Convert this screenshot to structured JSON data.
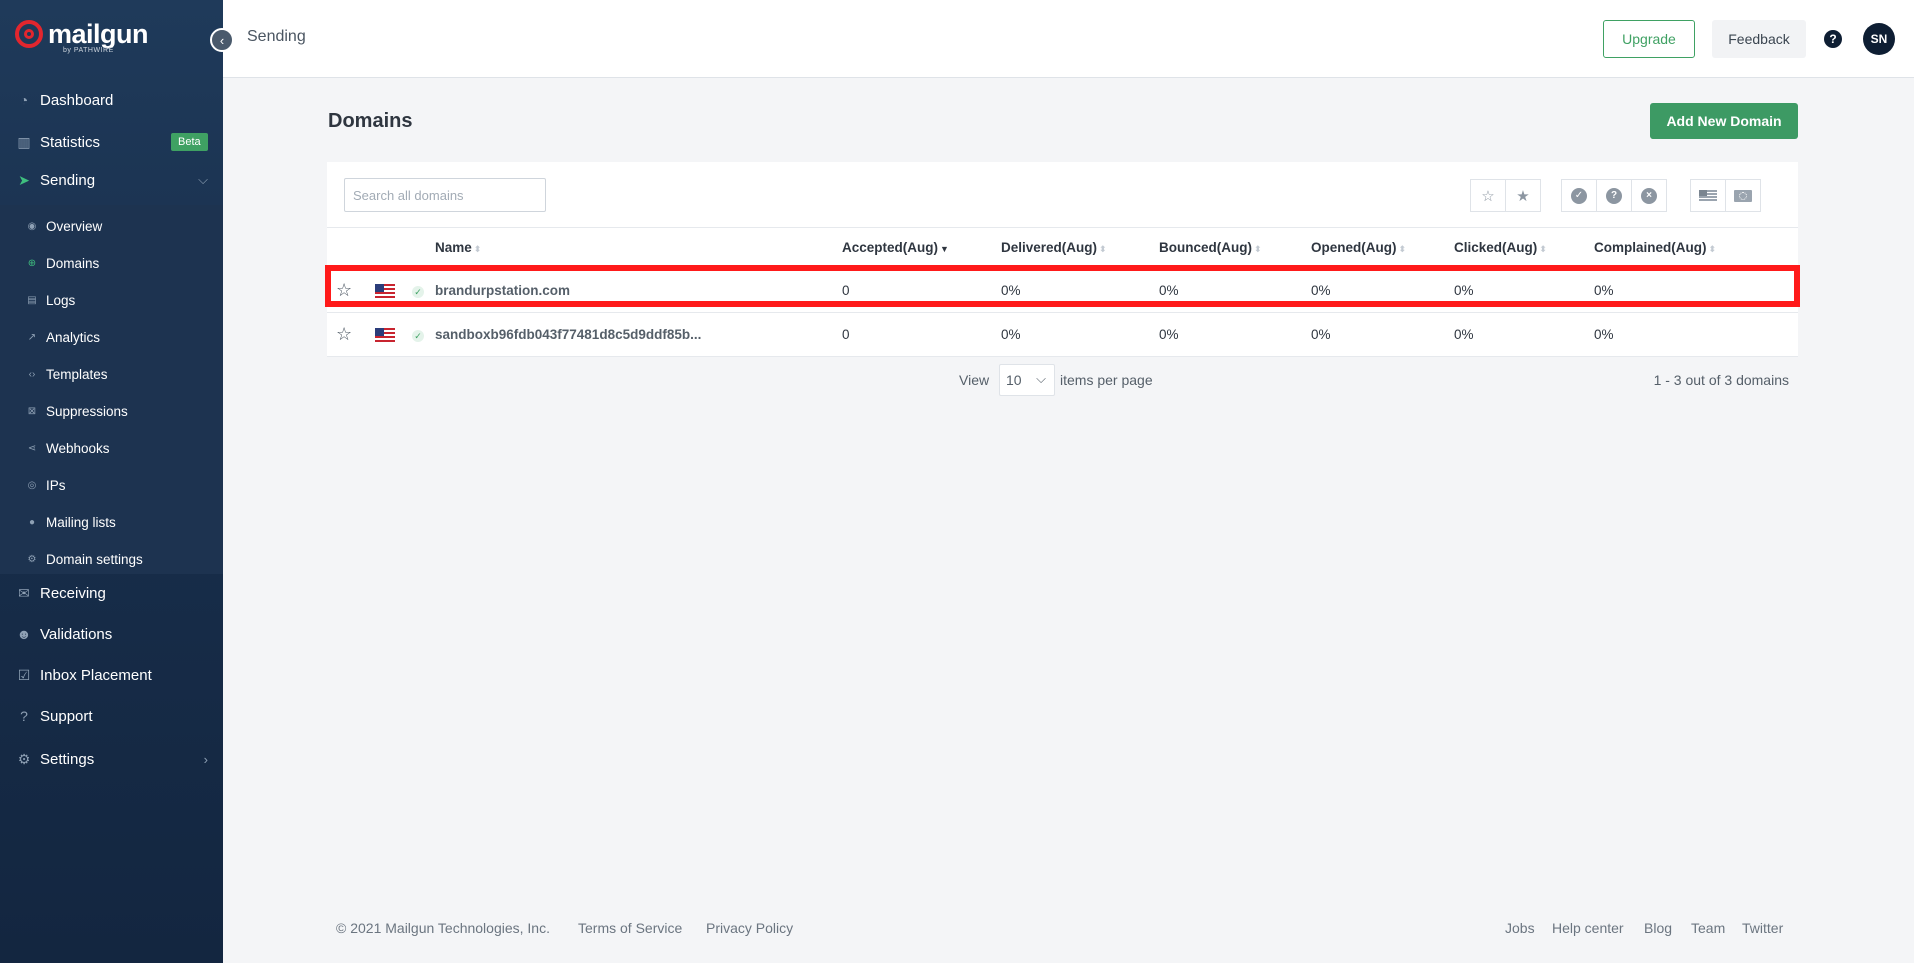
{
  "app": {
    "brand": "mailgun",
    "brand_sub": "by PATHWIRE"
  },
  "sidebar": {
    "items": [
      {
        "label": "Dashboard",
        "icon": "dashboard-icon"
      },
      {
        "label": "Statistics",
        "icon": "bar-chart-icon",
        "badge": "Beta"
      },
      {
        "label": "Sending",
        "icon": "paper-plane-icon",
        "expanded": true
      },
      {
        "label": "Receiving",
        "icon": "inbox-icon"
      },
      {
        "label": "Validations",
        "icon": "user-check-icon"
      },
      {
        "label": "Inbox Placement",
        "icon": "check-square-icon"
      },
      {
        "label": "Support",
        "icon": "question-circle-icon"
      },
      {
        "label": "Settings",
        "icon": "gear-icon"
      }
    ],
    "sending_sub": [
      {
        "label": "Overview",
        "icon": "eye-icon"
      },
      {
        "label": "Domains",
        "icon": "globe-icon",
        "active": true
      },
      {
        "label": "Logs",
        "icon": "document-icon"
      },
      {
        "label": "Analytics",
        "icon": "trend-icon"
      },
      {
        "label": "Templates",
        "icon": "code-icon"
      },
      {
        "label": "Suppressions",
        "icon": "block-icon"
      },
      {
        "label": "Webhooks",
        "icon": "share-icon"
      },
      {
        "label": "IPs",
        "icon": "location-icon"
      },
      {
        "label": "Mailing lists",
        "icon": "person-icon"
      },
      {
        "label": "Domain settings",
        "icon": "cog-icon"
      }
    ]
  },
  "header": {
    "breadcrumb": "Sending",
    "upgrade_label": "Upgrade",
    "feedback_label": "Feedback",
    "help_glyph": "?",
    "avatar_initials": "SN"
  },
  "main": {
    "title": "Domains",
    "add_button": "Add New Domain",
    "search_placeholder": "Search all domains",
    "columns": [
      "Name",
      "Accepted(Aug)",
      "Delivered(Aug)",
      "Bounced(Aug)",
      "Opened(Aug)",
      "Clicked(Aug)",
      "Complained(Aug)"
    ],
    "sorted_column": "Accepted(Aug)",
    "rows": [
      {
        "name": "brandurpstation.com",
        "accepted": "0",
        "delivered": "0%",
        "bounced": "0%",
        "opened": "0%",
        "clicked": "0%",
        "complained": "0%",
        "highlighted": true
      },
      {
        "name": "sandboxb96fdb043f77481d8c5d9ddf85b...",
        "accepted": "0",
        "delivered": "0%",
        "bounced": "0%",
        "opened": "0%",
        "clicked": "0%",
        "complained": "0%"
      }
    ],
    "pager": {
      "view_label": "View",
      "per_page": "10",
      "per_page_label": "items per page",
      "count_text": "1 - 3 out of 3 domains"
    }
  },
  "footer": {
    "copyright": "© 2021 Mailgun Technologies, Inc.",
    "terms": "Terms of Service",
    "privacy": "Privacy Policy",
    "jobs": "Jobs",
    "help_center": "Help center",
    "blog": "Blog",
    "team": "Team",
    "twitter": "Twitter"
  },
  "colors": {
    "sidebar_bg": "#1f3a5a",
    "accent_green": "#3d9a64",
    "highlight_red": "#ff1a1a"
  }
}
